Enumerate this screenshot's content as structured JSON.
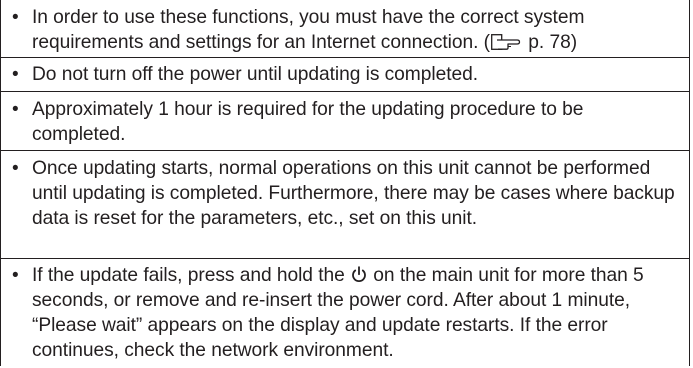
{
  "notes": {
    "item1": {
      "text_before_ref": "In order to use these functions, you must have the correct system requirements and settings for an Internet connection. (",
      "ref_icon": "reference-hand-icon",
      "page_ref": " p. 78)"
    },
    "item2": {
      "text": "Do not turn off the power until updating is completed."
    },
    "item3": {
      "text": "Approximately 1 hour is required for the updating procedure to be completed."
    },
    "item4": {
      "text": "Once updating starts, normal operations on this unit cannot be performed until updating is completed. Furthermore, there may be cases where backup data is reset for the parameters, etc., set on this unit."
    },
    "item5": {
      "text_before_icon": "If the update fails, press and hold the ",
      "power_icon": "power-icon",
      "text_after_icon": " on the main unit for more than 5 seconds, or remove and re-insert the power cord. After about 1 minute, “Please wait” appears on the display and update restarts. If the error continues, check the network environment."
    }
  },
  "colors": {
    "text": "#231f20",
    "border": "#231f20",
    "background": "#ffffff"
  }
}
